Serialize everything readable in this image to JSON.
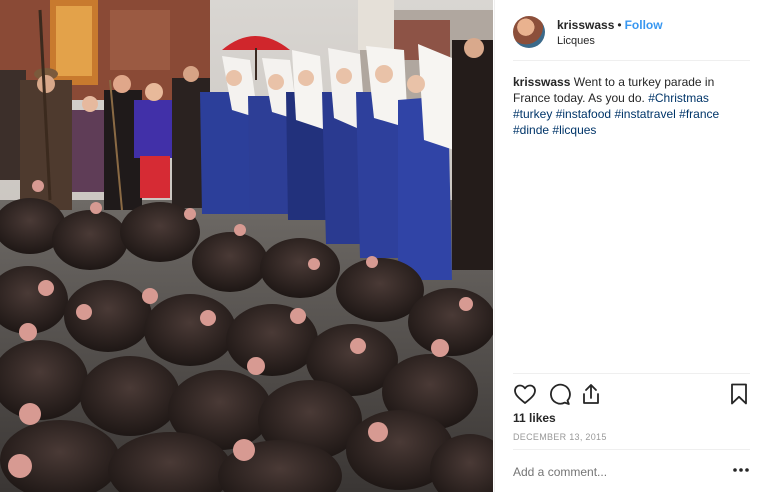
{
  "post": {
    "username": "krisswass",
    "dot": "•",
    "follow_label": "Follow",
    "location": "Licques",
    "caption_text": "Went to a turkey parade in France today. As you do.",
    "hashtags": [
      "#Christmas",
      "#turkey",
      "#instafood",
      "#instatravel",
      "#france",
      "#dinde",
      "#licques"
    ],
    "likes": "11 likes",
    "date": "DECEMBER 13, 2015",
    "comment_placeholder": "Add a comment...",
    "more_label": "•••"
  },
  "icons": {
    "like": "heart-icon",
    "comment": "comment-bubble-icon",
    "share": "share-icon",
    "save": "bookmark-icon"
  },
  "colors": {
    "follow": "#3897f0",
    "hashtag": "#003569",
    "muted": "#999999"
  }
}
